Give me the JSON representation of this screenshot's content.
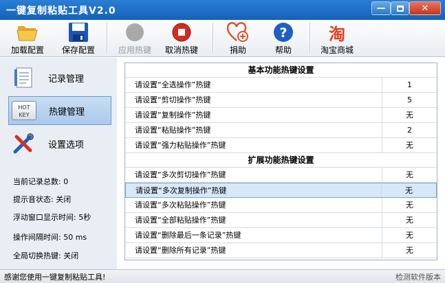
{
  "window": {
    "title": "一键复制粘贴工具V2.0"
  },
  "toolbar": {
    "items": [
      {
        "label": "加载配置",
        "icon": "folder-open-icon",
        "enabled": true
      },
      {
        "label": "保存配置",
        "icon": "floppy-disk-icon",
        "enabled": true
      },
      {
        "label": "应用热键",
        "icon": "apply-hotkey-icon",
        "enabled": false
      },
      {
        "label": "取消热键",
        "icon": "stop-icon",
        "enabled": true
      },
      {
        "label": "捐助",
        "icon": "heart-plus-icon",
        "enabled": true
      },
      {
        "label": "帮助",
        "icon": "help-icon",
        "enabled": true
      },
      {
        "label": "淘宝商城",
        "icon": "taobao-icon",
        "enabled": true
      }
    ],
    "taobao_glyph": "淘"
  },
  "sidebar": {
    "items": [
      {
        "label": "记录管理",
        "active": false
      },
      {
        "label": "热键管理",
        "active": true,
        "icon_text_top": "HOT",
        "icon_text_bottom": "KEY"
      },
      {
        "label": "设置选项",
        "active": false
      }
    ],
    "stats": [
      "当前记录总数: 0",
      "提示音状态: 关闭",
      "浮动窗口显示时间: 5秒",
      "操作间隔时间: 50 ms",
      "全局切换热键: 关闭"
    ]
  },
  "main": {
    "section_basic": "基本功能热键设置",
    "basic_rows": [
      {
        "label": "请设置“全选操作”热键",
        "value": "1"
      },
      {
        "label": "请设置“剪切操作”热键",
        "value": "5"
      },
      {
        "label": "请设置“复制操作”热键",
        "value": "无"
      },
      {
        "label": "请设置“粘贴操作”热键",
        "value": "2"
      },
      {
        "label": "请设置“强力粘贴操作”热键",
        "value": "无"
      }
    ],
    "section_ext": "扩展功能热键设置",
    "ext_rows": [
      {
        "label": "请设置“多次剪切操作”热键",
        "value": "无",
        "selected": false
      },
      {
        "label": "请设置“多次复制操作”热键",
        "value": "无",
        "selected": true
      },
      {
        "label": "请设置“多次粘贴操作”热键",
        "value": "无",
        "selected": false
      },
      {
        "label": "请设置“全部粘贴操作”热键",
        "value": "无",
        "selected": false
      },
      {
        "label": "请设置“删除最后一条记录”热键",
        "value": "无",
        "selected": false
      },
      {
        "label": "请设置“删除所有记录”热键",
        "value": "无",
        "selected": false
      }
    ]
  },
  "statusbar": {
    "message": "感谢您使用一键复制粘贴工具!",
    "right": "检测软件版本"
  },
  "colors": {
    "titlebar": "#1e6fc8",
    "selection": "#d7e8f8",
    "close_button": "#c2361b"
  }
}
